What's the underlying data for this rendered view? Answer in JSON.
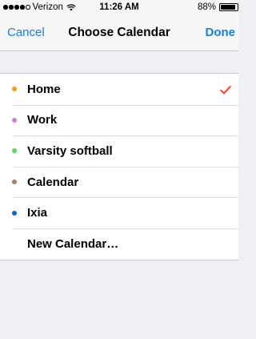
{
  "status_bar": {
    "carrier": "Verizon",
    "time": "11:26 AM",
    "battery_percent": "88%",
    "battery_level": 0.88,
    "signal_bars": 4,
    "signal_max": 5,
    "wifi_icon": "wifi-icon"
  },
  "nav": {
    "cancel_label": "Cancel",
    "title": "Choose Calendar",
    "done_label": "Done",
    "accent_color": "#1a7dd8"
  },
  "calendars": [
    {
      "label": "Home",
      "color": "#f39c12",
      "selected": true
    },
    {
      "label": "Work",
      "color": "#c879e0",
      "selected": false
    },
    {
      "label": "Varsity softball",
      "color": "#4cd964",
      "selected": false
    },
    {
      "label": "Calendar",
      "color": "#a2845e",
      "selected": false
    },
    {
      "label": "Ixia",
      "color": "#1d62b8",
      "selected": false
    }
  ],
  "new_calendar_label": "New Calendar…",
  "checkmark_color": "#ff3b30"
}
